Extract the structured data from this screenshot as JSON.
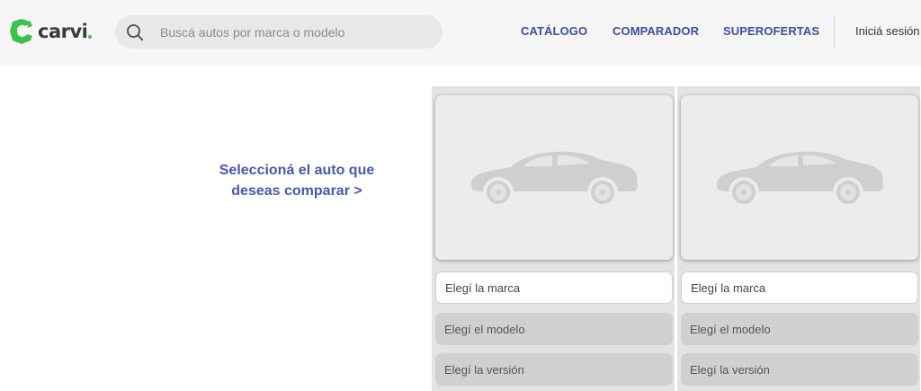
{
  "brand": {
    "name": "carvi",
    "accent_color": "#3cc34b"
  },
  "search": {
    "placeholder": "Buscá autos por marca o modelo",
    "value": ""
  },
  "nav": {
    "catalog": "CATÁLOGO",
    "comparator": "COMPARADOR",
    "offers": "SUPEROFERTAS",
    "login": "Iniciá sesión"
  },
  "main": {
    "prompt_line1": "Seleccioná el auto que",
    "prompt_line2": "deseas comparar >"
  },
  "compare_slots": [
    {
      "brand_select": "Elegí la marca",
      "model_select": "Elegí el modelo",
      "version_select": "Elegí la versión"
    },
    {
      "brand_select": "Elegí la marca",
      "model_select": "Elegí el modelo",
      "version_select": "Elegí la versión"
    }
  ],
  "icons": {
    "search": "search-icon",
    "car_placeholder": "car-placeholder-icon",
    "logo": "carvi-logo-icon"
  },
  "colors": {
    "nav_text": "#3a4fa3",
    "prompt_text": "#4558b6",
    "header_bg": "#f6f6f6"
  }
}
